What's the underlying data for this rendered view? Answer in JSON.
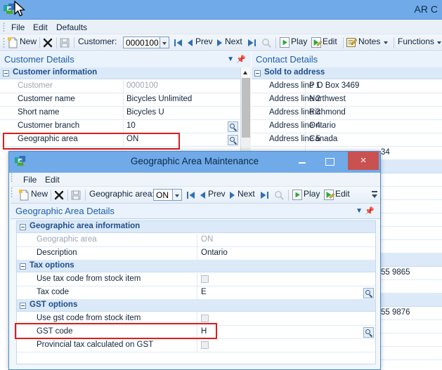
{
  "app": {
    "title": "AR C",
    "icon": "app-icon",
    "cursor": "mouse-pointer-icon"
  },
  "menubar": {
    "items": [
      "File",
      "Edit",
      "Defaults"
    ]
  },
  "toolbar": {
    "new_label": "New",
    "delete_icon": "delete-x-icon",
    "save_icon": "save-disk-icon",
    "customer_label": "Customer:",
    "customer_value": "0000100",
    "first_icon": "first-record-icon",
    "prev_label": "Prev",
    "next_label": "Next",
    "last_icon": "last-record-icon",
    "search_icon": "search-magnifier-icon",
    "play_label": "Play",
    "edit_label": "Edit",
    "notes_label": "Notes",
    "functions_label": "Functions"
  },
  "customer_panel": {
    "header": "Customer Details",
    "group": "Customer information",
    "rows": [
      {
        "label": "Customer",
        "value": "0000100",
        "dim": true,
        "lookup": false
      },
      {
        "label": "Customer name",
        "value": "Bicycles Unlimited",
        "dim": false,
        "lookup": false
      },
      {
        "label": "Short name",
        "value": "Bicycles U",
        "dim": false,
        "lookup": false
      },
      {
        "label": "Customer branch",
        "value": "10",
        "dim": false,
        "lookup": true
      },
      {
        "label": "Geographic area",
        "value": "ON",
        "dim": false,
        "lookup": true
      }
    ]
  },
  "contact_panel": {
    "header": "Contact Details",
    "group": "Sold to address",
    "rows": [
      {
        "label": "Address line 1",
        "value": "P O Box 3469"
      },
      {
        "label": "Address line 2",
        "value": "Northwest"
      },
      {
        "label": "Address line 3",
        "value": "Richmond"
      },
      {
        "label": "Address line 4",
        "value": "Ontario"
      },
      {
        "label": "Address line 5",
        "value": "Canada"
      }
    ],
    "obscured_fragments": [
      "34",
      "55 9865",
      "55 9876"
    ]
  },
  "dialog": {
    "title": "Geographic Area Maintenance",
    "icon": "app-icon",
    "window_controls": {
      "minimize": "minimize-icon",
      "maximize": "maximize-icon",
      "close": "×"
    },
    "menubar": {
      "items": [
        "File",
        "Edit"
      ]
    },
    "toolbar": {
      "new_label": "New",
      "delete_icon": "delete-x-icon",
      "save_icon": "save-disk-icon",
      "geo_label": "Geographic area:",
      "geo_value": "ON",
      "first_icon": "first-record-icon",
      "prev_label": "Prev",
      "next_label": "Next",
      "last_icon": "last-record-icon",
      "search_icon": "search-magnifier-icon",
      "play_label": "Play",
      "edit_label": "Edit",
      "overflow_icon": "toolbar-overflow-icon"
    },
    "panel_header": "Geographic Area Details",
    "groups": [
      {
        "title": "Geographic area information",
        "rows": [
          {
            "label": "Geographic area",
            "value": "ON",
            "type": "text",
            "dim": true,
            "lookup": false
          },
          {
            "label": "Description",
            "value": "Ontario",
            "type": "text",
            "dim": false,
            "lookup": false
          }
        ]
      },
      {
        "title": "Tax options",
        "rows": [
          {
            "label": "Use tax code from stock item",
            "value": "",
            "type": "checkbox",
            "checked": false,
            "dim": false,
            "lookup": false
          },
          {
            "label": "Tax code",
            "value": "E",
            "type": "text",
            "dim": false,
            "lookup": true
          }
        ]
      },
      {
        "title": "GST options",
        "rows": [
          {
            "label": "Use gst code from stock item",
            "value": "",
            "type": "checkbox",
            "checked": false,
            "dim": false,
            "lookup": false
          },
          {
            "label": "GST code",
            "value": "H",
            "type": "text",
            "dim": false,
            "lookup": true
          },
          {
            "label": "Provincial tax calculated on GST",
            "value": "",
            "type": "checkbox",
            "checked": false,
            "dim": false,
            "lookup": false
          }
        ]
      }
    ]
  },
  "highlights": {
    "color": "#e01b1b",
    "boxes": [
      "geographic-area-row",
      "gst-code-row"
    ]
  }
}
